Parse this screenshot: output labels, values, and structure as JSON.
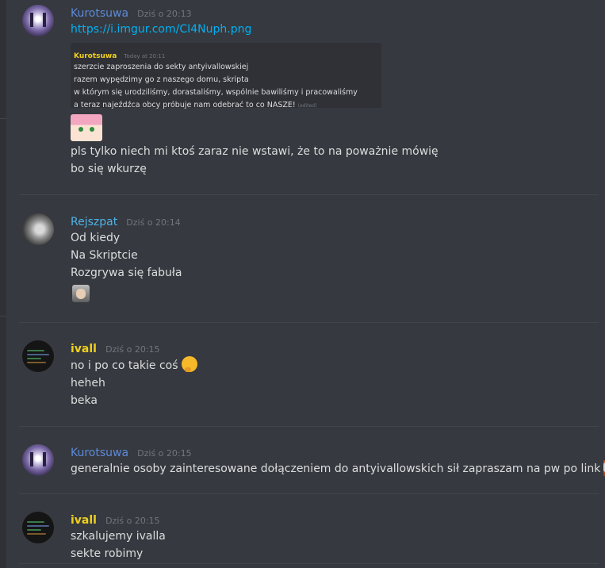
{
  "messages": [
    {
      "author": "Kurotsuwa",
      "timestamp": "Dziś o 20:13",
      "link": "https://i.imgur.com/CI4Nuph.png",
      "embed": {
        "author": "Kurotsuwa",
        "timestamp": "Today at 20:11",
        "lines": [
          "szerzcie zaproszenia do sekty antyivallowskiej",
          "razem wypędzimy go z naszego domu, skripta",
          "w którym się urodziliśmy, dorastaliśmy, wspólnie bawiliśmy i pracowaliśmy",
          "a teraz najeźdźca obcy próbuje nam odebrać to co NASZE!"
        ],
        "edited": "(edited)"
      },
      "lines": [
        "pls tylko niech mi ktoś zaraz nie wstawi, że to na poważnie mówię",
        "bo się wkurzę"
      ]
    },
    {
      "author": "Rejszpat",
      "timestamp": "Dziś o 20:14",
      "lines": [
        "Od kiedy",
        "Na Skriptcie",
        "Rozgrywa się fabuła"
      ]
    },
    {
      "author": "ivall",
      "timestamp": "Dziś o 20:15",
      "lines": [
        "no i po co takie coś",
        "heheh",
        "beka"
      ]
    },
    {
      "author": "Kurotsuwa",
      "timestamp": "Dziś o 20:15",
      "lines": [
        "generalnie osoby zainteresowane dołączeniem do antyivallowskich sił zapraszam na pw po link"
      ]
    },
    {
      "author": "ivall",
      "timestamp": "Dziś o 20:15",
      "lines": [
        "szkalujemy ivalla",
        "sekte robimy"
      ]
    }
  ],
  "icons": {
    "embed_sticker": "anime-girl-sticker-icon",
    "kappa": "kappa-emote-icon",
    "thinking": "thinking-face-emoji-icon",
    "brick": "brick-wall-emote-icon"
  },
  "colors": {
    "background": "#36393f",
    "kurotsuwa_name": "#5c8ad8",
    "rejszpat_name": "#4fb3e8",
    "ivall_name": "#f0d01a",
    "link": "#00b0f4"
  }
}
